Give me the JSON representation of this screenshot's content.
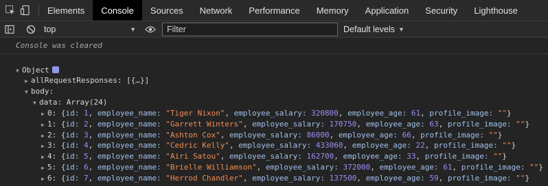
{
  "tabs": [
    "Elements",
    "Console",
    "Sources",
    "Network",
    "Performance",
    "Memory",
    "Application",
    "Security",
    "Lighthouse"
  ],
  "toolbar": {
    "context": "top",
    "filter_placeholder": "Filter",
    "levels": "Default levels"
  },
  "console": {
    "cleared": "Console was cleared",
    "object_label": "Object",
    "all_requests": "allRequestResponses:",
    "all_requests_value": "[{…}]",
    "body": "body:",
    "data_label": "data:",
    "data_value": "Array(24)",
    "employees": [
      {
        "index": "0",
        "id": "1",
        "name": "\"Tiger Nixon\"",
        "salary": "320800",
        "age": "61"
      },
      {
        "index": "1",
        "id": "2",
        "name": "\"Garrett Winters\"",
        "salary": "170750",
        "age": "63"
      },
      {
        "index": "2",
        "id": "3",
        "name": "\"Ashton Cox\"",
        "salary": "86000",
        "age": "66"
      },
      {
        "index": "3",
        "id": "4",
        "name": "\"Cedric Kelly\"",
        "salary": "433060",
        "age": "22"
      },
      {
        "index": "4",
        "id": "5",
        "name": "\"Airi Satou\"",
        "salary": "162700",
        "age": "33"
      },
      {
        "index": "5",
        "id": "6",
        "name": "\"Brielle Williamson\"",
        "salary": "372000",
        "age": "61"
      },
      {
        "index": "6",
        "id": "7",
        "name": "\"Herrod Chandler\"",
        "salary": "137500",
        "age": "59"
      }
    ],
    "profile_image_value": "\"\""
  },
  "icons": [
    "inspect-icon",
    "device-toggle-icon",
    "sidebar-toggle-icon",
    "clear-console-icon",
    "eye-icon"
  ],
  "colors": {
    "background": "#242424",
    "string": "#f28b54",
    "number": "#9a8ff5",
    "property": "#a1c1ea"
  }
}
